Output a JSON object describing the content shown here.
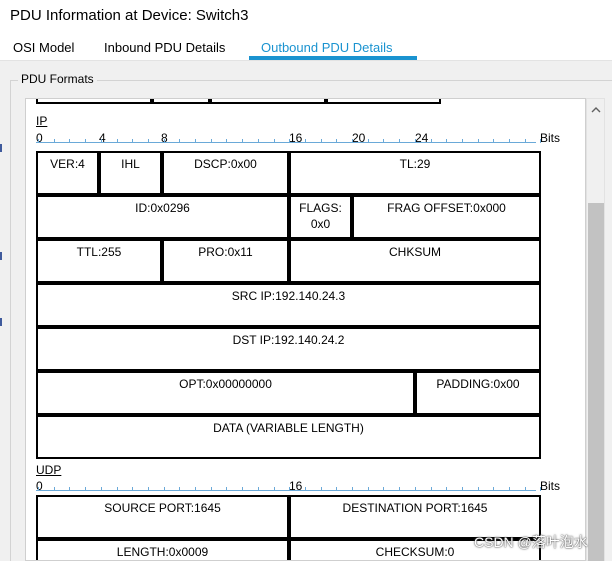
{
  "window": {
    "title": "PDU Information at Device: Switch3"
  },
  "tabs": [
    {
      "label": "OSI Model"
    },
    {
      "label": "Inbound PDU Details"
    },
    {
      "label": "Outbound PDU Details"
    }
  ],
  "group": {
    "label": "PDU Formats"
  },
  "ip": {
    "label": "IP",
    "ruler": [
      "0",
      "4",
      "8",
      "16",
      "20",
      "24",
      "Bits"
    ],
    "fields": {
      "ver": "VER:4",
      "ihl": "IHL",
      "dscp": "DSCP:0x00",
      "tl": "TL:29",
      "id": "ID:0x0296",
      "flags_line1": "FLAGS:",
      "flags_line2": "0x0",
      "frag_offset": "FRAG OFFSET:0x000",
      "ttl": "TTL:255",
      "pro": "PRO:0x11",
      "chksum": "CHKSUM",
      "src_ip": "SRC IP:192.140.24.3",
      "dst_ip": "DST IP:192.140.24.2",
      "opt": "OPT:0x00000000",
      "padding": "PADDING:0x00",
      "data": "DATA (VARIABLE LENGTH)"
    }
  },
  "udp": {
    "label": "UDP",
    "ruler": [
      "0",
      "16",
      "Bits"
    ],
    "fields": {
      "source_port": "SOURCE PORT:1645",
      "destination_port": "DESTINATION PORT:1645",
      "length": "LENGTH:0x0009",
      "checksum": "CHECKSUM:0"
    }
  },
  "watermark": "CSDN @落叶泡水",
  "colors": {
    "accent": "#1a93d0",
    "ruler": "#6aa9d8",
    "panel": "#f0f0f0"
  },
  "icons": {
    "scroll_up": "chevron-up-icon"
  }
}
